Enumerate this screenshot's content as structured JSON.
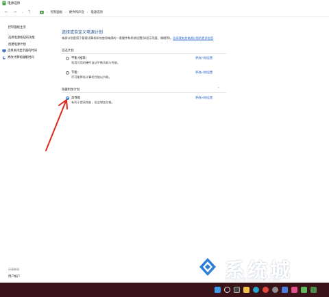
{
  "window": {
    "title": "电源选项",
    "app_icon": "power-options-icon"
  },
  "addressbar": {
    "back_icon": "arrow-left-icon",
    "forward_icon": "arrow-right-icon",
    "recent_icon": "chevron-down-icon",
    "up_icon": "arrow-up-icon",
    "breadcrumbs": [
      "控制面板",
      "硬件和声音",
      "电源选项"
    ]
  },
  "sidebar": {
    "home": "控制面板主页",
    "links": [
      "选择电源按钮的功能",
      "创建电源计划",
      "选择关闭显示器的时间",
      "更改计算机睡眠时间"
    ],
    "see_also": "另请参阅",
    "user_accounts": "用户帐户"
  },
  "main": {
    "heading": "选择或自定义电源计划",
    "description": "电源计划是用于管理计算机如何使用电源的一套硬件和系统设置(如显示亮度、睡眠等)。",
    "description_link": "告诉我有关电源计划的更多信息",
    "preferred_title": "首选计划",
    "hidden_title": "隐藏附加计划",
    "change_settings_label": "更改计划设置",
    "plans": [
      {
        "name": "平衡 (推荐)",
        "desc": "利用可用的硬件自动平衡功耗与性能。",
        "checked": false
      },
      {
        "name": "节能",
        "desc": "尽可能降低计算机性能以节能。",
        "checked": false
      },
      {
        "name": "高性能",
        "desc": "有利于提高性能，但会增加功耗。",
        "checked": true
      }
    ]
  },
  "annotation": {
    "arrow_color": "#d9281e"
  },
  "watermark": {
    "text": "系统城",
    "subtext": "XITONGCHENG.COM",
    "accent": "#2b7fd6"
  },
  "taskbar": {
    "background": "#3a1318",
    "icons": [
      "start-icon",
      "search-icon",
      "task-view-icon",
      "file-explorer-icon",
      "edge-icon",
      "chrome-icon",
      "settings-icon",
      "store-icon",
      "media-icon",
      "app-icon",
      "control-panel-icon"
    ]
  },
  "accent": "#1f5ec9"
}
